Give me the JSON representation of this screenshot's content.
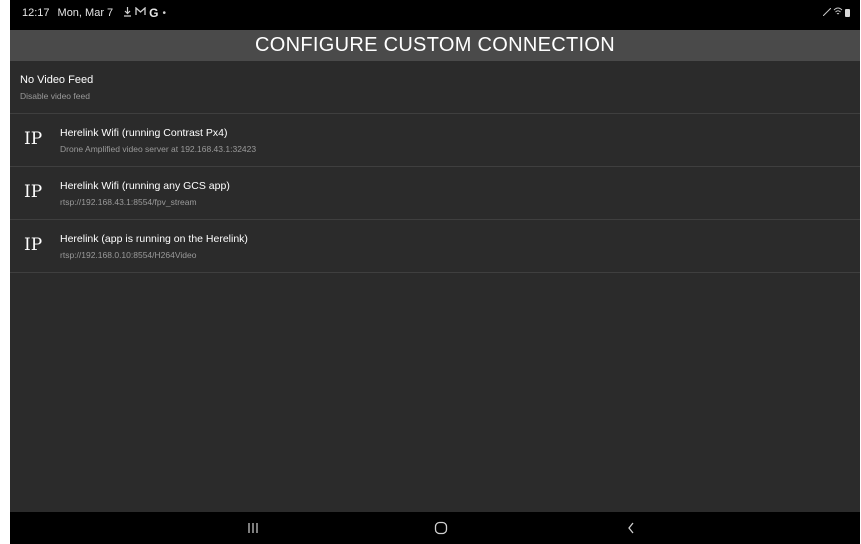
{
  "status_bar": {
    "time": "12:17",
    "date": "Mon, Mar 7",
    "icons": [
      "download-icon",
      "gmail-icon",
      "google-icon",
      "dot-icon"
    ],
    "right_icons": [
      "signal-icon",
      "wifi-icon",
      "battery-icon"
    ]
  },
  "header": {
    "title": "CONFIGURE CUSTOM CONNECTION"
  },
  "no_video": {
    "title": "No Video Feed",
    "subtitle": "Disable video feed"
  },
  "connections": [
    {
      "icon_label": "IP",
      "title": "Herelink Wifi (running Contrast Px4)",
      "subtitle": "Drone Amplified video server at 192.168.43.1:32423"
    },
    {
      "icon_label": "IP",
      "title": "Herelink Wifi (running any GCS app)",
      "subtitle": "rtsp://192.168.43.1:8554/fpv_stream"
    },
    {
      "icon_label": "IP",
      "title": "Herelink (app is running on the Herelink)",
      "subtitle": "rtsp://192.168.0.10:8554/H264Video"
    }
  ],
  "nav": {
    "buttons": [
      "recents-icon",
      "home-icon",
      "back-icon"
    ]
  },
  "colors": {
    "title_bar": "#4a4a4a",
    "content_bg": "#2b2b2b",
    "divider": "#3f3f3f",
    "secondary_text": "#9a9a9a"
  }
}
